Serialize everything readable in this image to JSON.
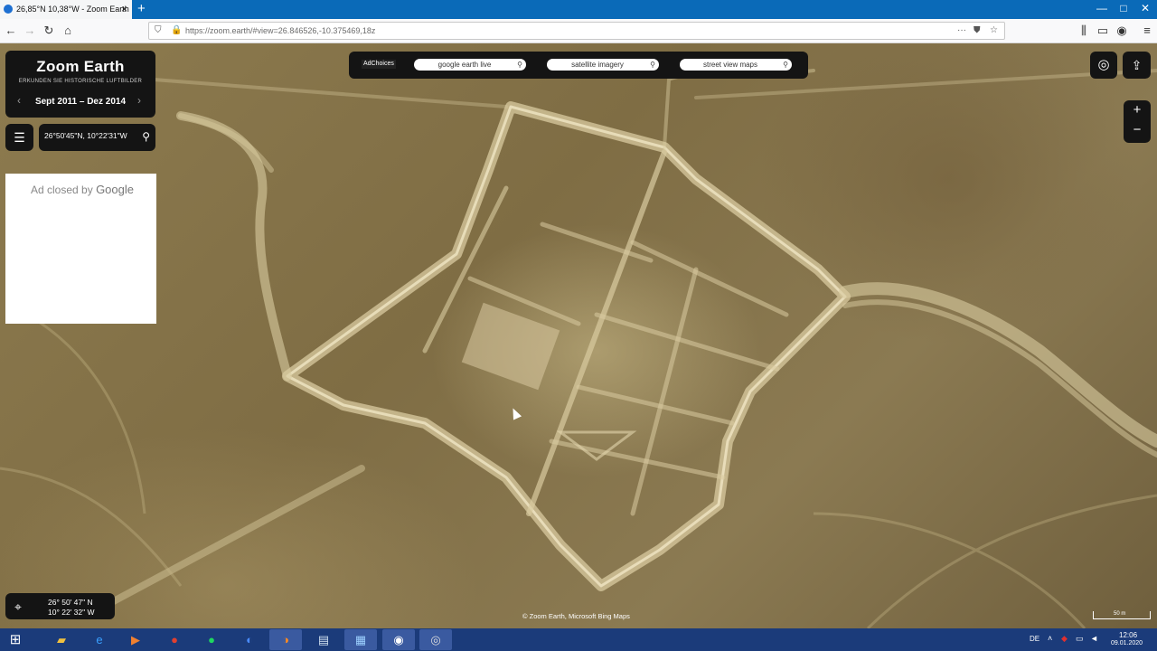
{
  "browser": {
    "tab_title": "26,85°N 10,38°W - Zoom Earth",
    "new_tab": "+",
    "url": "https://zoom.earth/#view=26.846526,-10.375469,18z",
    "window_controls": [
      "—",
      "□",
      "✕"
    ]
  },
  "zoom_earth": {
    "title": "Zoom Earth",
    "subtitle": "ERKUNDEN SIE HISTORISCHE LUFTBILDER",
    "date_range": "Sept 2011 – Dez 2014",
    "search_value": "26°50'45\"N, 10°22'31\"W",
    "ad_closed": "Ad closed by",
    "ad_brand": "Google",
    "adchoices": "AdChoices",
    "pills": [
      "google earth live",
      "satellite imagery",
      "street view maps"
    ],
    "coord_lat": "26° 50' 47\" N",
    "coord_lon": "10° 22' 32\" W",
    "attribution": "© Zoom Earth, Microsoft Bing Maps",
    "scale": "50 m"
  },
  "icons": {
    "menu": "☰",
    "search": "⚲",
    "prev": "‹",
    "next": "›",
    "zoom_in": "+",
    "zoom_out": "−",
    "share": "⇪",
    "layers": "◎",
    "locate": "⌖"
  },
  "taskbar": {
    "start": "⊞",
    "apps": [
      "explorer",
      "ie",
      "media",
      "chrome",
      "spotify",
      "firefox-dev",
      "firefox",
      "app",
      "app2",
      "obs",
      "app3"
    ],
    "lang": "DE",
    "time": "12:06",
    "date": "09.01.2020"
  },
  "colors": {
    "panel": "#141414",
    "tabstrip": "#0a6ab8",
    "taskbar": "#1b3b7a"
  }
}
